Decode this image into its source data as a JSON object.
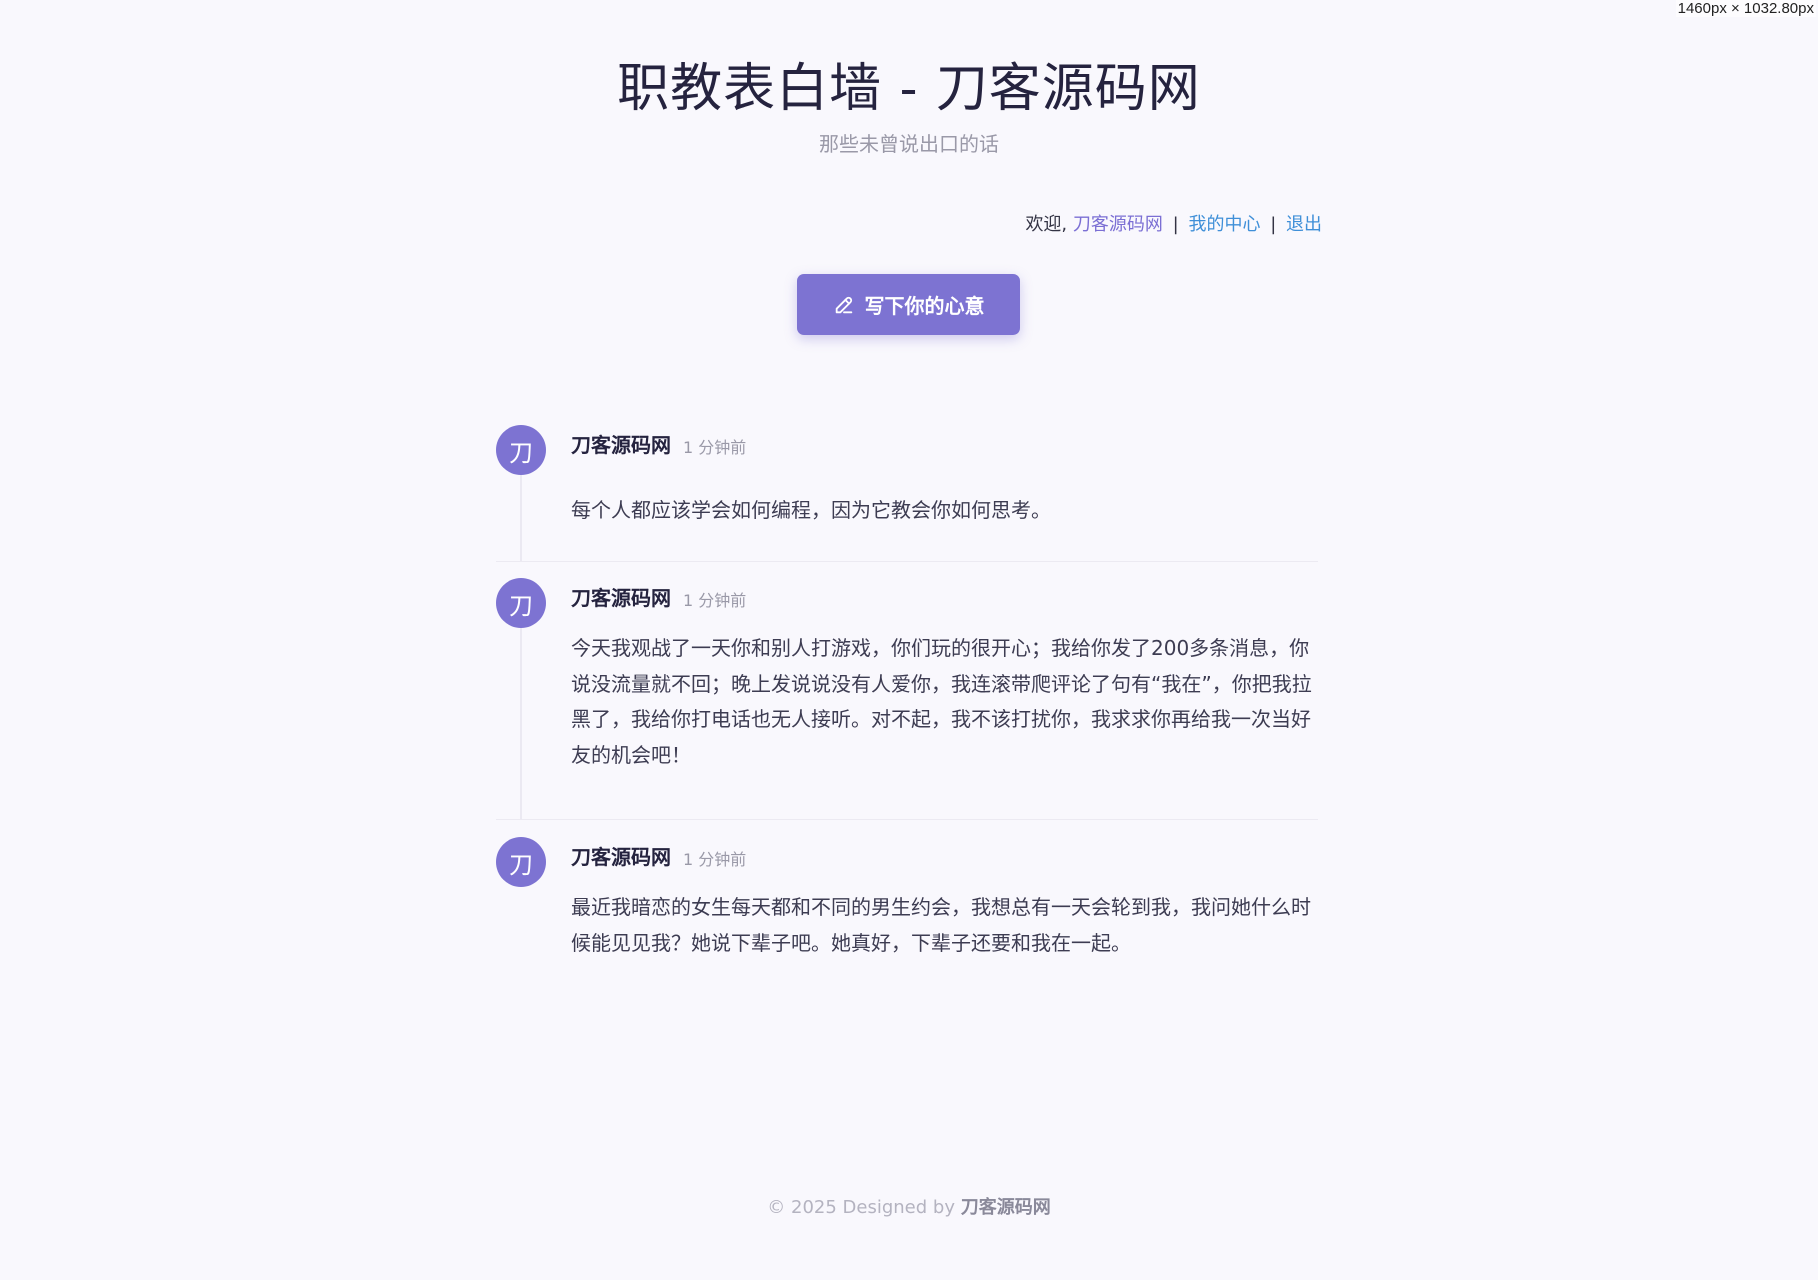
{
  "viewport_label": "1460px × 1032.80px",
  "header": {
    "title": "职教表白墙 - 刀客源码网",
    "subtitle": "那些未曾说出口的话"
  },
  "user_bar": {
    "welcome": "欢迎,",
    "username": "刀客源码网",
    "separator": "|",
    "center_link": "我的中心",
    "logout_link": "退出"
  },
  "write_button": {
    "label": "写下你的心意",
    "icon": "pencil-icon"
  },
  "posts": [
    {
      "avatar": "刀",
      "author": "刀客源码网",
      "time": "1 分钟前",
      "content": "  每个人都应该学会如何编程，因为它教会你如何思考。"
    },
    {
      "avatar": "刀",
      "author": "刀客源码网",
      "time": "1 分钟前",
      "content": "  今天我观战了一天你和别人打游戏，你们玩的很开心；我给你发了200多条消息，你说没流量就不回；晚上发说说没有人爱你，我连滚带爬评论了句有“我在”，你把我拉黑了，我给你打电话也无人接听。对不起，我不该打扰你，我求求你再给我一次当好友的机会吧！"
    },
    {
      "avatar": "刀",
      "author": "刀客源码网",
      "time": "1 分钟前",
      "content": "  最近我暗恋的女生每天都和不同的男生约会，我想总有一天会轮到我，我问她什么时候能见见我？她说下辈子吧。她真好，下辈子还要和我在一起。"
    }
  ],
  "footer": {
    "prefix": "© 2025 Designed by ",
    "brand": "刀客源码网"
  },
  "colors": {
    "accent": "#7d73d2",
    "link_blue": "#3f8fd8",
    "background": "#f9f8fd"
  }
}
